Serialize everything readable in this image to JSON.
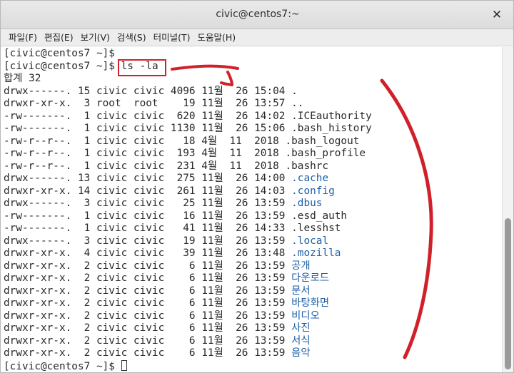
{
  "window": {
    "title": "civic@centos7:~",
    "close_glyph": "✕"
  },
  "menu": [
    "파일(F)",
    "편집(E)",
    "보기(V)",
    "검색(S)",
    "터미널(T)",
    "도움말(H)"
  ],
  "terminal": {
    "prompt": "[civic@centos7 ~]$ ",
    "command": "ls -la",
    "total": "합계 32",
    "entries": [
      {
        "perm": "drwx------.",
        "links": "15",
        "owner": "civic",
        "group": "civic",
        "size": "4096",
        "date": "11월  26 15:04",
        "name": ".",
        "dir": false
      },
      {
        "perm": "drwxr-xr-x.",
        "links": "3",
        "owner": "root",
        "group": "root",
        "size": "19",
        "date": "11월  26 13:57",
        "name": "..",
        "dir": false
      },
      {
        "perm": "-rw-------.",
        "links": "1",
        "owner": "civic",
        "group": "civic",
        "size": "620",
        "date": "11월  26 14:02",
        "name": ".ICEauthority",
        "dir": false
      },
      {
        "perm": "-rw-------.",
        "links": "1",
        "owner": "civic",
        "group": "civic",
        "size": "1130",
        "date": "11월  26 15:06",
        "name": ".bash_history",
        "dir": false
      },
      {
        "perm": "-rw-r--r--.",
        "links": "1",
        "owner": "civic",
        "group": "civic",
        "size": "18",
        "date": "4월  11  2018",
        "name": ".bash_logout",
        "dir": false
      },
      {
        "perm": "-rw-r--r--.",
        "links": "1",
        "owner": "civic",
        "group": "civic",
        "size": "193",
        "date": "4월  11  2018",
        "name": ".bash_profile",
        "dir": false
      },
      {
        "perm": "-rw-r--r--.",
        "links": "1",
        "owner": "civic",
        "group": "civic",
        "size": "231",
        "date": "4월  11  2018",
        "name": ".bashrc",
        "dir": false
      },
      {
        "perm": "drwx------.",
        "links": "13",
        "owner": "civic",
        "group": "civic",
        "size": "275",
        "date": "11월  26 14:00",
        "name": ".cache",
        "dir": true
      },
      {
        "perm": "drwxr-xr-x.",
        "links": "14",
        "owner": "civic",
        "group": "civic",
        "size": "261",
        "date": "11월  26 14:03",
        "name": ".config",
        "dir": true
      },
      {
        "perm": "drwx------.",
        "links": "3",
        "owner": "civic",
        "group": "civic",
        "size": "25",
        "date": "11월  26 13:59",
        "name": ".dbus",
        "dir": true
      },
      {
        "perm": "-rw-------.",
        "links": "1",
        "owner": "civic",
        "group": "civic",
        "size": "16",
        "date": "11월  26 13:59",
        "name": ".esd_auth",
        "dir": false
      },
      {
        "perm": "-rw-------.",
        "links": "1",
        "owner": "civic",
        "group": "civic",
        "size": "41",
        "date": "11월  26 14:33",
        "name": ".lesshst",
        "dir": false
      },
      {
        "perm": "drwx------.",
        "links": "3",
        "owner": "civic",
        "group": "civic",
        "size": "19",
        "date": "11월  26 13:59",
        "name": ".local",
        "dir": true
      },
      {
        "perm": "drwxr-xr-x.",
        "links": "4",
        "owner": "civic",
        "group": "civic",
        "size": "39",
        "date": "11월  26 13:48",
        "name": ".mozilla",
        "dir": true
      },
      {
        "perm": "drwxr-xr-x.",
        "links": "2",
        "owner": "civic",
        "group": "civic",
        "size": "6",
        "date": "11월  26 13:59",
        "name": "공개",
        "dir": true
      },
      {
        "perm": "drwxr-xr-x.",
        "links": "2",
        "owner": "civic",
        "group": "civic",
        "size": "6",
        "date": "11월  26 13:59",
        "name": "다운로드",
        "dir": true
      },
      {
        "perm": "drwxr-xr-x.",
        "links": "2",
        "owner": "civic",
        "group": "civic",
        "size": "6",
        "date": "11월  26 13:59",
        "name": "문서",
        "dir": true
      },
      {
        "perm": "drwxr-xr-x.",
        "links": "2",
        "owner": "civic",
        "group": "civic",
        "size": "6",
        "date": "11월  26 13:59",
        "name": "바탕화면",
        "dir": true
      },
      {
        "perm": "drwxr-xr-x.",
        "links": "2",
        "owner": "civic",
        "group": "civic",
        "size": "6",
        "date": "11월  26 13:59",
        "name": "비디오",
        "dir": true
      },
      {
        "perm": "drwxr-xr-x.",
        "links": "2",
        "owner": "civic",
        "group": "civic",
        "size": "6",
        "date": "11월  26 13:59",
        "name": "사진",
        "dir": true
      },
      {
        "perm": "drwxr-xr-x.",
        "links": "2",
        "owner": "civic",
        "group": "civic",
        "size": "6",
        "date": "11월  26 13:59",
        "name": "서식",
        "dir": true
      },
      {
        "perm": "drwxr-xr-x.",
        "links": "2",
        "owner": "civic",
        "group": "civic",
        "size": "6",
        "date": "11월  26 13:59",
        "name": "음악",
        "dir": true
      }
    ]
  },
  "colors": {
    "directory": "#1f5fa8",
    "annotation": "#d0202a"
  }
}
